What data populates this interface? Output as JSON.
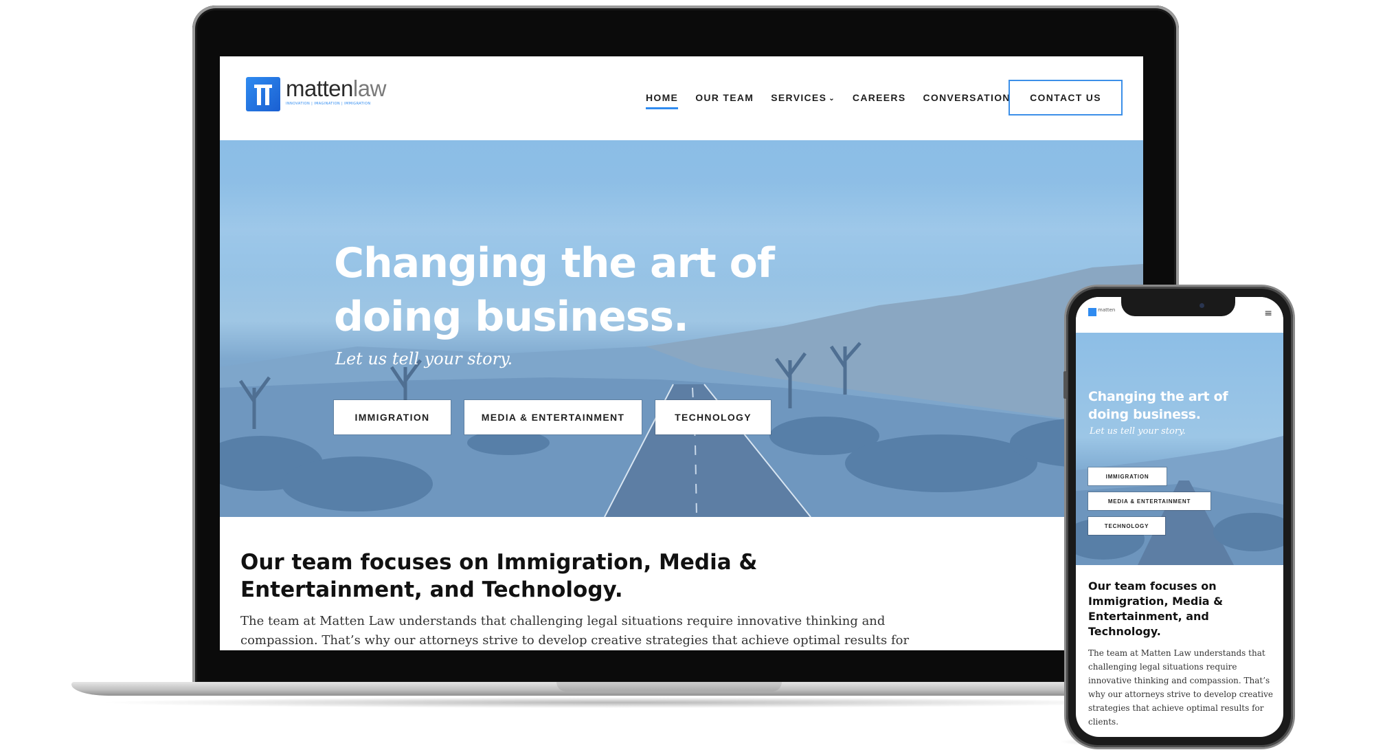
{
  "desktop": {
    "logo": {
      "name_bold": "matten",
      "name_light": "law",
      "tagline": "INNOVATION | IMAGINATION | IMMIGRATION"
    },
    "nav": [
      {
        "label": "HOME",
        "active": true
      },
      {
        "label": "OUR TEAM",
        "active": false
      },
      {
        "label": "SERVICES",
        "active": false
      },
      {
        "label": "CAREERS",
        "active": false
      },
      {
        "label": "CONVERSATION",
        "active": false
      }
    ],
    "contact_label": "CONTACT US",
    "hero": {
      "title_line1": "Changing the art of",
      "title_line2": "doing business.",
      "subtitle": "Let us tell your story.",
      "buttons": [
        "IMMIGRATION",
        "MEDIA & ENTERTAINMENT",
        "TECHNOLOGY"
      ]
    },
    "content": {
      "title": "Our team focuses on Immigration, Media & Entertainment, and Technology.",
      "body": "The team at Matten Law understands that challenging legal situations require innovative thinking and compassion. That’s why our attorneys strive to develop creative strategies that achieve optimal results for"
    }
  },
  "mobile": {
    "logo_text": "matten",
    "hero": {
      "title_line1": "Changing the art of",
      "title_line2": "doing business.",
      "subtitle": "Let us tell your story.",
      "buttons": [
        "IMMIGRATION",
        "MEDIA & ENTERTAINMENT",
        "TECHNOLOGY"
      ]
    },
    "content": {
      "title": "Our team focuses on Immigration, Media & Entertainment, and Technology.",
      "body": "The team at Matten Law understands that challenging legal situations require innovative thinking and compassion. That’s why our attorneys strive to develop creative strategies that achieve optimal results for clients."
    }
  },
  "colors": {
    "accent": "#2f8bf0",
    "hero_tint": "#8bbde6",
    "text_dark": "#111111"
  },
  "icons": [
    "logo-mark-icon",
    "chevron-down-icon",
    "hamburger-menu-icon"
  ]
}
